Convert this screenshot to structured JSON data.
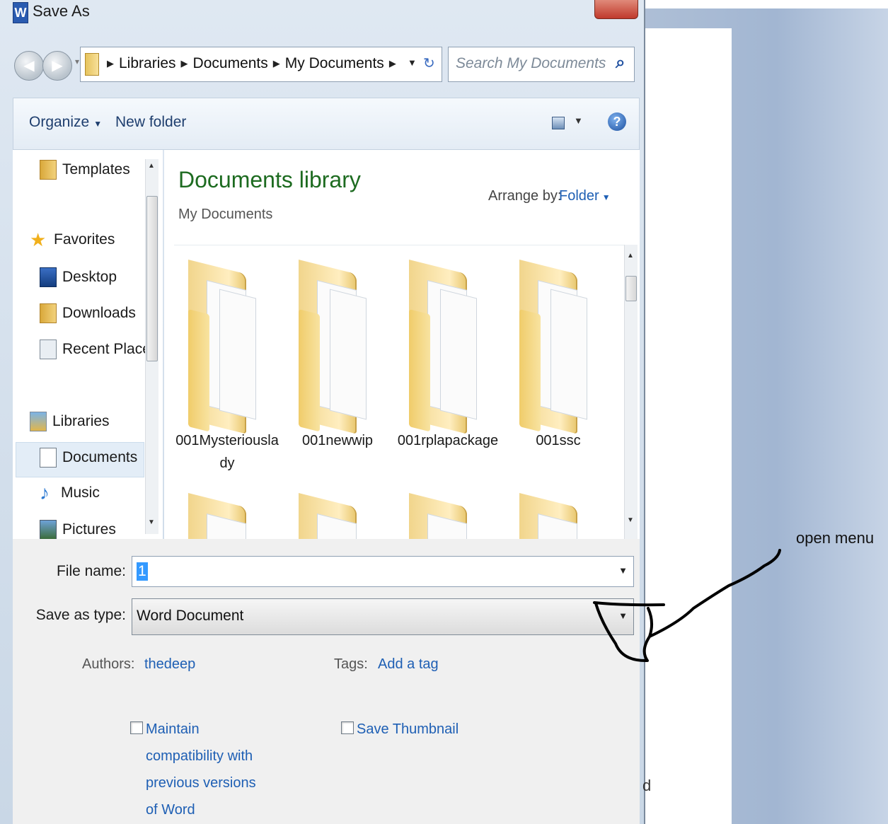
{
  "window": {
    "title": "Save As",
    "app_icon_letter": "W"
  },
  "address_bar": {
    "breadcrumbs": [
      "Libraries",
      "Documents",
      "My Documents"
    ],
    "search_placeholder": "Search My Documents"
  },
  "toolbar": {
    "organize_label": "Organize",
    "new_folder_label": "New folder"
  },
  "nav_pane": {
    "items": [
      {
        "label": "Templates",
        "icon": "folder-icon"
      },
      {
        "label": "Favorites",
        "icon": "star-icon"
      },
      {
        "label": "Desktop",
        "icon": "desktop-icon"
      },
      {
        "label": "Downloads",
        "icon": "downloads-icon"
      },
      {
        "label": "Recent Places",
        "icon": "recent-places-icon"
      },
      {
        "label": "Libraries",
        "icon": "libraries-icon"
      },
      {
        "label": "Documents",
        "icon": "document-icon",
        "selected": true
      },
      {
        "label": "Music",
        "icon": "music-icon"
      },
      {
        "label": "Pictures",
        "icon": "pictures-icon"
      }
    ]
  },
  "content": {
    "library_title": "Documents library",
    "library_subtitle": "My Documents",
    "arrange_by_label": "Arrange by:",
    "arrange_by_value": "Folder",
    "folders": [
      {
        "name": "001Mysteriouslady"
      },
      {
        "name": "001newwip"
      },
      {
        "name": "001rplapackage"
      },
      {
        "name": "001ssc"
      }
    ]
  },
  "form": {
    "file_name_label": "File name:",
    "file_name_value": "1",
    "save_as_type_label": "Save as type:",
    "save_as_type_value": "Word Document",
    "authors_label": "Authors:",
    "authors_value": "thedeep",
    "tags_label": "Tags:",
    "tags_value": "Add a tag",
    "maintain_compat_label": "Maintain compatibility with previous versions of Word",
    "save_thumbnail_label": "Save Thumbnail"
  },
  "annotation": {
    "text": "open menu"
  }
}
